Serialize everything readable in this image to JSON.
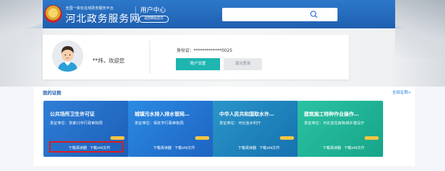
{
  "header": {
    "subtitle": "全国一体化在线政务服务平台",
    "brand_name": "河北政务服务网",
    "user_center": "用户中心",
    "home_button": "返回网站首页",
    "search": {
      "value": "",
      "icon": "search-icon"
    },
    "background_color": "#2d78c9"
  },
  "profile": {
    "avatar_icon": "user-avatar-icon",
    "welcome": "**炜，欢迎您",
    "id_card": "身份证：*************0025",
    "account_button": "账户设置",
    "logout_button": "退出登录"
  },
  "certificates": {
    "section_title": "我的证照",
    "all_link": "全部证照>",
    "items": [
      {
        "title": "公共场所卫生许可证",
        "issuer": "发证单位：张家口市行政审批局",
        "download_reader": "下载阅读器",
        "download_ofd": "下载ofd文件",
        "color": "#2f7ed6"
      },
      {
        "title": "城镇污水排入排水管网…",
        "issuer": "发证单位：保定市行政审批局",
        "download_reader": "下载阅读器",
        "download_ofd": "下载ofd文件",
        "color": "#2b8ae2"
      },
      {
        "title": "中华人民共和国取水许…",
        "issuer": "发证单位：河北省水利厅",
        "download_reader": "下载阅读器",
        "download_ofd": "下载ofd文件",
        "color": "#2a95c8"
      },
      {
        "title": "建筑施工特种作业操作…",
        "issuer": "发证单位：河北省住房和城乡建设厅",
        "download_reader": "下载阅读器",
        "download_ofd": "下载ofd文件",
        "color": "#2bc2a2"
      }
    ]
  },
  "highlight_color": "#e0191f"
}
